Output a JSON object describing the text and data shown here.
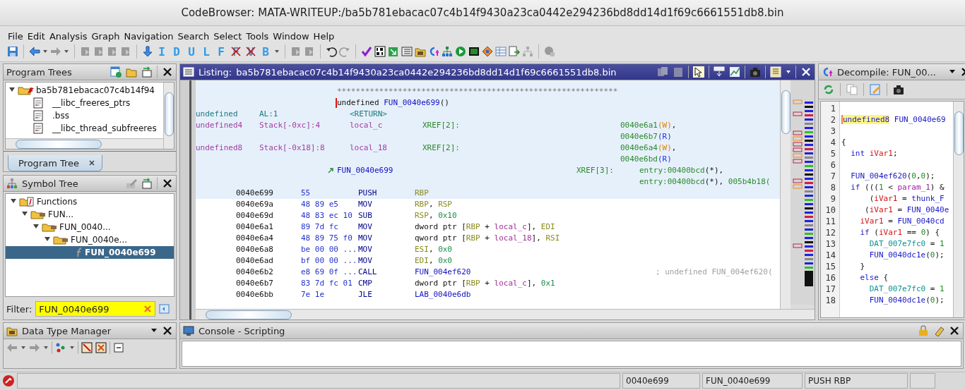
{
  "window": {
    "title": "CodeBrowser: MATA-WRITEUP:/ba5b781ebacac07c4b14f9430a23ca0442e294236bd8dd14d1f69c6661551db8.bin"
  },
  "menu": [
    "File",
    "Edit",
    "Analysis",
    "Graph",
    "Navigation",
    "Search",
    "Select",
    "Tools",
    "Window",
    "Help"
  ],
  "toolbar_letters": [
    {
      "label": "I",
      "struck": false
    },
    {
      "label": "D",
      "struck": false
    },
    {
      "label": "U",
      "struck": false
    },
    {
      "label": "L",
      "struck": false
    },
    {
      "label": "F",
      "struck": false
    },
    {
      "label": "F",
      "struck": true
    },
    {
      "label": "V",
      "struck": true
    },
    {
      "label": "B",
      "struck": false
    }
  ],
  "program_trees": {
    "title": "Program Trees",
    "root": {
      "label": "ba5b781ebacac07c4b14f94",
      "expanded": true,
      "children": [
        {
          "label": "__libc_freeres_ptrs"
        },
        {
          "label": ".bss"
        },
        {
          "label": "__libc_thread_subfreeres"
        }
      ]
    },
    "tab": {
      "label": "Program Tree",
      "selected": true
    }
  },
  "symbol_tree": {
    "title": "Symbol Tree",
    "items": [
      {
        "label": "Functions",
        "kind": "category",
        "expanded": true,
        "children": [
          {
            "label": "FUN...",
            "kind": "folder",
            "expanded": true,
            "children": [
              {
                "label": "FUN_0040...",
                "kind": "folder",
                "expanded": true,
                "children": [
                  {
                    "label": "FUN_0040e...",
                    "kind": "folder",
                    "expanded": true,
                    "children": [
                      {
                        "label": "FUN_0040e699",
                        "kind": "function",
                        "selected": true
                      }
                    ]
                  }
                ]
              }
            ]
          }
        ]
      }
    ],
    "filter": {
      "label": "Filter:",
      "value": "FUN_0040e699"
    }
  },
  "listing": {
    "title": "Listing:",
    "file": "ba5b781ebacac07c4b14f9430a23ca0442e294236bd8dd14d1f69c6661551db8.bin",
    "separator": "************************************************************",
    "signature": {
      "return_type": "undefined",
      "name": "FUN_0040e699",
      "params": "()"
    },
    "variables": [
      {
        "type": "undefined",
        "kind": "return",
        "storage": "AL:1",
        "name": "<RETURN>"
      },
      {
        "type": "undefined4",
        "kind": "local",
        "storage": "Stack[-0xc]:4",
        "name": "local_c",
        "xref_label": "XREF[2]:",
        "xref_lines": [
          [
            {
              "target": "0040e6a1",
              "access": "(W)",
              "kind": "write",
              "sep": ","
            }
          ],
          [
            {
              "target": "0040e6b7",
              "access": "(R)",
              "kind": "read"
            }
          ]
        ]
      },
      {
        "type": "undefined8",
        "kind": "local",
        "storage": "Stack[-0x18]:8",
        "name": "local_18",
        "xref_label": "XREF[2]:",
        "xref_lines": [
          [
            {
              "target": "0040e6a4",
              "access": "(W)",
              "kind": "write",
              "sep": ","
            }
          ],
          [
            {
              "target": "0040e6bd",
              "access": "(R)",
              "kind": "read"
            }
          ]
        ]
      }
    ],
    "label": {
      "name": "FUN_0040e699",
      "xref_label": "XREF[3]:",
      "xref_lines": [
        [
          {
            "target": "entry:00400bcd",
            "access": "(*)",
            "kind": "any",
            "sep": ","
          }
        ],
        [
          {
            "target": "entry:00400bcd",
            "access": "(*)",
            "kind": "any",
            "sep": ", "
          },
          {
            "target": "005b4b18("
          }
        ]
      ]
    },
    "rows": [
      {
        "address": "0040e699",
        "bytes": "55",
        "mnemonic": "PUSH",
        "operands": [
          {
            "text": "RBP",
            "kind": "register"
          }
        ],
        "selected": true
      },
      {
        "address": "0040e69a",
        "bytes": "48 89 e5",
        "mnemonic": "MOV",
        "operands": [
          {
            "text": "RBP",
            "kind": "register"
          },
          {
            "text": ", ",
            "kind": "plain"
          },
          {
            "text": "RSP",
            "kind": "register"
          }
        ],
        "selected": false
      },
      {
        "address": "0040e69d",
        "bytes": "48 83 ec 10",
        "mnemonic": "SUB",
        "operands": [
          {
            "text": "RSP",
            "kind": "register"
          },
          {
            "text": ", ",
            "kind": "plain"
          },
          {
            "text": "0x10",
            "kind": "number"
          }
        ],
        "selected": false
      },
      {
        "address": "0040e6a1",
        "bytes": "89 7d fc",
        "mnemonic": "MOV",
        "operands": [
          {
            "text": "dword ptr [",
            "kind": "plain"
          },
          {
            "text": "RBP",
            "kind": "register"
          },
          {
            "text": " + ",
            "kind": "plain"
          },
          {
            "text": "local_c",
            "kind": "variable"
          },
          {
            "text": "], ",
            "kind": "plain"
          },
          {
            "text": "EDI",
            "kind": "register"
          }
        ],
        "selected": false
      },
      {
        "address": "0040e6a4",
        "bytes": "48 89 75 f0",
        "mnemonic": "MOV",
        "operands": [
          {
            "text": "qword ptr [",
            "kind": "plain"
          },
          {
            "text": "RBP",
            "kind": "register"
          },
          {
            "text": " + ",
            "kind": "plain"
          },
          {
            "text": "local_18",
            "kind": "variable"
          },
          {
            "text": "], ",
            "kind": "plain"
          },
          {
            "text": "RSI",
            "kind": "register"
          }
        ],
        "selected": false
      },
      {
        "address": "0040e6a8",
        "bytes": "be 00 00 ...",
        "mnemonic": "MOV",
        "operands": [
          {
            "text": "ESI",
            "kind": "register"
          },
          {
            "text": ", ",
            "kind": "plain"
          },
          {
            "text": "0x0",
            "kind": "number"
          }
        ],
        "selected": false
      },
      {
        "address": "0040e6ad",
        "bytes": "bf 00 00 ...",
        "mnemonic": "MOV",
        "operands": [
          {
            "text": "EDI",
            "kind": "register"
          },
          {
            "text": ", ",
            "kind": "plain"
          },
          {
            "text": "0x0",
            "kind": "number"
          }
        ],
        "selected": false
      },
      {
        "address": "0040e6b2",
        "bytes": "e8 69 0f ...",
        "mnemonic": "CALL",
        "operands": [
          {
            "text": "FUN_004ef620",
            "kind": "label"
          }
        ],
        "comment": "; undefined FUN_004ef620(",
        "selected": false
      },
      {
        "address": "0040e6b7",
        "bytes": "83 7d fc 01",
        "mnemonic": "CMP",
        "operands": [
          {
            "text": "dword ptr [",
            "kind": "plain"
          },
          {
            "text": "RBP",
            "kind": "register"
          },
          {
            "text": " + ",
            "kind": "plain"
          },
          {
            "text": "local_c",
            "kind": "variable"
          },
          {
            "text": "], ",
            "kind": "plain"
          },
          {
            "text": "0x1",
            "kind": "number"
          }
        ],
        "selected": false
      },
      {
        "address": "0040e6bb",
        "bytes": "7e 1e",
        "mnemonic": "JLE",
        "operands": [
          {
            "text": "LAB_0040e6db",
            "kind": "label"
          }
        ],
        "selected": false
      }
    ]
  },
  "decompile": {
    "title": "Decompile: FUN_00...",
    "lines": [
      {
        "number": "1"
      },
      {
        "number": "2",
        "tokens": [
          {
            "text": "undefined8",
            "kind": "highlight"
          },
          {
            "text": " FUN_0040e69",
            "kind": "function"
          }
        ]
      },
      {
        "number": "3"
      },
      {
        "number": "4",
        "tokens": [
          {
            "text": "{",
            "kind": "plain"
          }
        ]
      },
      {
        "number": "5",
        "tokens": [
          {
            "text": "  int",
            "kind": "keyword"
          },
          {
            "text": " iVar1",
            "kind": "variable"
          },
          {
            "text": ";",
            "kind": "plain"
          }
        ]
      },
      {
        "number": "6"
      },
      {
        "number": "7",
        "tokens": [
          {
            "text": "  FUN_004ef620",
            "kind": "function"
          },
          {
            "text": "(",
            "kind": "plain"
          },
          {
            "text": "0",
            "kind": "number"
          },
          {
            "text": ",",
            "kind": "plain"
          },
          {
            "text": "0",
            "kind": "number"
          },
          {
            "text": ");",
            "kind": "plain"
          }
        ]
      },
      {
        "number": "8",
        "tokens": [
          {
            "text": "  if",
            "kind": "keyword"
          },
          {
            "text": " (((",
            "kind": "plain"
          },
          {
            "text": "1",
            "kind": "number"
          },
          {
            "text": " < ",
            "kind": "plain"
          },
          {
            "text": "param_1",
            "kind": "param"
          },
          {
            "text": ") &",
            "kind": "plain"
          }
        ]
      },
      {
        "number": "9",
        "tokens": [
          {
            "text": "      (",
            "kind": "plain"
          },
          {
            "text": "iVar1",
            "kind": "variable"
          },
          {
            "text": " = ",
            "kind": "plain"
          },
          {
            "text": "thunk_F",
            "kind": "function"
          }
        ]
      },
      {
        "number": "10",
        "tokens": [
          {
            "text": "     (",
            "kind": "plain"
          },
          {
            "text": "iVar1",
            "kind": "variable"
          },
          {
            "text": " = ",
            "kind": "plain"
          },
          {
            "text": "FUN_0040e",
            "kind": "function"
          }
        ]
      },
      {
        "number": "11",
        "tokens": [
          {
            "text": "    iVar1",
            "kind": "variable"
          },
          {
            "text": " = ",
            "kind": "plain"
          },
          {
            "text": "FUN_0040cd",
            "kind": "function"
          }
        ]
      },
      {
        "number": "12",
        "tokens": [
          {
            "text": "    if",
            "kind": "keyword"
          },
          {
            "text": " (",
            "kind": "plain"
          },
          {
            "text": "iVar1",
            "kind": "variable"
          },
          {
            "text": " == ",
            "kind": "plain"
          },
          {
            "text": "0",
            "kind": "number"
          },
          {
            "text": ") {",
            "kind": "plain"
          }
        ]
      },
      {
        "number": "13",
        "tokens": [
          {
            "text": "      DAT_007e7fc0",
            "kind": "global"
          },
          {
            "text": " = ",
            "kind": "plain"
          },
          {
            "text": "1",
            "kind": "number"
          }
        ]
      },
      {
        "number": "14",
        "tokens": [
          {
            "text": "      FUN_0040dc1e",
            "kind": "function"
          },
          {
            "text": "(",
            "kind": "plain"
          },
          {
            "text": "0",
            "kind": "number"
          },
          {
            "text": ");",
            "kind": "plain"
          }
        ]
      },
      {
        "number": "15",
        "tokens": [
          {
            "text": "    }",
            "kind": "plain"
          }
        ]
      },
      {
        "number": "16",
        "tokens": [
          {
            "text": "    else",
            "kind": "keyword"
          },
          {
            "text": " {",
            "kind": "plain"
          }
        ]
      },
      {
        "number": "17",
        "tokens": [
          {
            "text": "      DAT_007e7fc0",
            "kind": "global"
          },
          {
            "text": " = ",
            "kind": "plain"
          },
          {
            "text": "1",
            "kind": "number"
          }
        ]
      },
      {
        "number": "18",
        "tokens": [
          {
            "text": "      FUN_0040dc1e",
            "kind": "function"
          },
          {
            "text": "(",
            "kind": "plain"
          },
          {
            "text": "0",
            "kind": "number"
          },
          {
            "text": ");",
            "kind": "plain"
          }
        ]
      }
    ]
  },
  "data_type_manager": {
    "title": "Data Type Manager"
  },
  "console": {
    "title": "Console - Scripting"
  },
  "status_bar": [
    "0040e699",
    "FUN_0040e699",
    "PUSH RBP"
  ]
}
